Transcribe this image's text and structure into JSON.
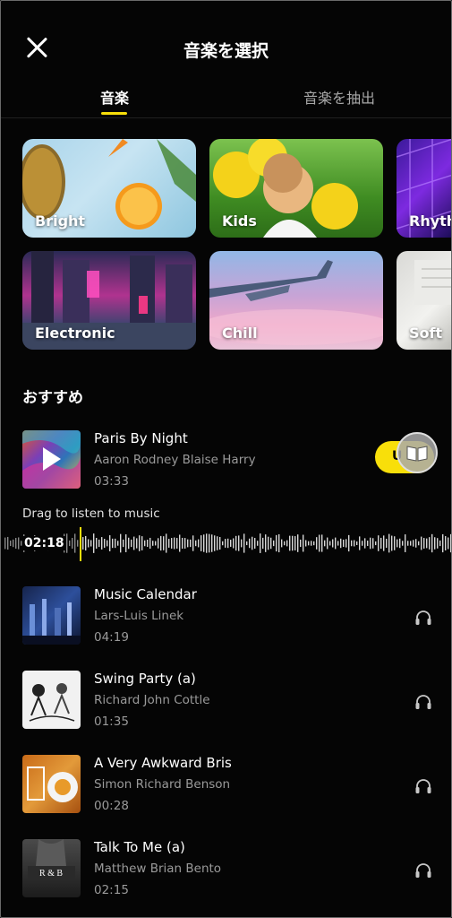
{
  "header": {
    "title": "音楽を選択"
  },
  "tabs": [
    {
      "label": "音楽",
      "active": true
    },
    {
      "label": "音楽を抽出",
      "active": false
    }
  ],
  "categories": [
    {
      "label": "Bright"
    },
    {
      "label": "Kids"
    },
    {
      "label": "Rhythm"
    },
    {
      "label": "Electronic"
    },
    {
      "label": "Chill"
    },
    {
      "label": "Soft"
    }
  ],
  "section": {
    "title": "おすすめ"
  },
  "now_playing": {
    "title": "Paris By Night",
    "artist": "Aaron Rodney Blaise Harry",
    "duration": "03:33",
    "use_label": "U",
    "hint": "Drag to listen to music",
    "position": "02:18"
  },
  "tracks": [
    {
      "title": "Music Calendar",
      "artist": "Lars-Luis  Linek",
      "duration": "04:19"
    },
    {
      "title": "Swing Party (a)",
      "artist": "Richard John Cottle",
      "duration": "01:35"
    },
    {
      "title": "A Very Awkward Bris",
      "artist": "Simon Richard Benson",
      "duration": "00:28"
    },
    {
      "title": "Talk To Me (a)",
      "artist": "Matthew Brian Bento",
      "duration": "02:15"
    }
  ],
  "colors": {
    "accent": "#f8df0a",
    "background": "#050505",
    "secondary_text": "#9a9a9a"
  },
  "icons": {
    "close": "close-icon",
    "headphones": "headphones-icon",
    "play": "play-icon",
    "book": "book-icon"
  }
}
